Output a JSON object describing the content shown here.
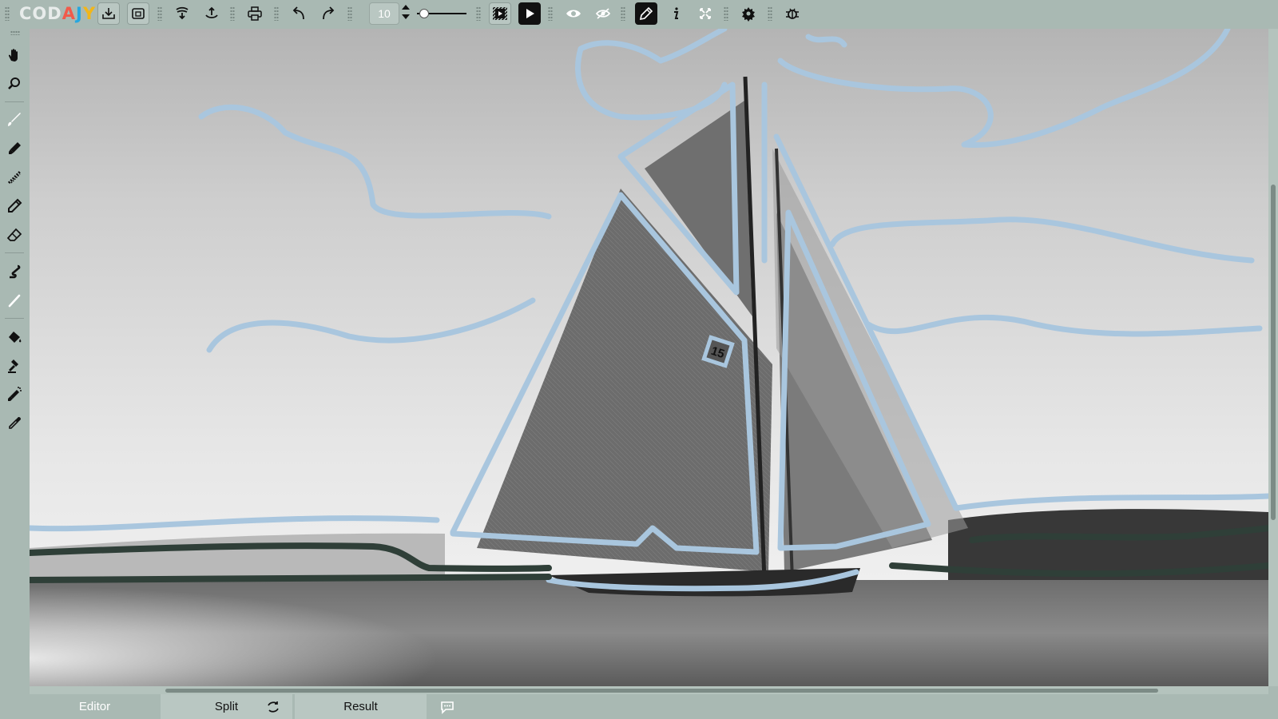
{
  "app": {
    "logo_letters": [
      {
        "char": "C",
        "color": "#e8eceb"
      },
      {
        "char": "O",
        "color": "#e8eceb"
      },
      {
        "char": "D",
        "color": "#e8eceb"
      },
      {
        "char": "A",
        "color": "#f15a4a"
      },
      {
        "char": "J",
        "color": "#26a7e0"
      },
      {
        "char": "Y",
        "color": "#f2b619"
      }
    ]
  },
  "toolbar": {
    "brush_size": "10",
    "slider_level": 0.05,
    "buttons": [
      {
        "name": "import-button",
        "icon": "download-tray-icon"
      },
      {
        "name": "gallery-button",
        "icon": "image-frame-icon"
      },
      {
        "name": "save-button",
        "icon": "save-icon"
      },
      {
        "name": "share-button",
        "icon": "share-icon"
      },
      {
        "name": "print-button",
        "icon": "printer-icon"
      },
      {
        "name": "undo-button",
        "icon": "undo-icon"
      },
      {
        "name": "redo-button",
        "icon": "redo-icon"
      },
      {
        "name": "playback-button",
        "icon": "playback-icon"
      },
      {
        "name": "play-button",
        "icon": "play-icon"
      },
      {
        "name": "preview-button",
        "icon": "eye-icon"
      },
      {
        "name": "hide-button",
        "icon": "eye-slash-icon"
      },
      {
        "name": "stylus-button",
        "icon": "stylus-icon"
      },
      {
        "name": "info-button",
        "icon": "info-icon"
      },
      {
        "name": "fullscreen-button",
        "icon": "expand-icon"
      },
      {
        "name": "settings-button",
        "icon": "gear-icon"
      },
      {
        "name": "debug-button",
        "icon": "bug-icon"
      }
    ]
  },
  "tools": [
    {
      "name": "hand-tool",
      "icon": "hand-icon"
    },
    {
      "name": "zoom-tool",
      "icon": "magnifier-icon"
    },
    {
      "name": "brush-tool",
      "icon": "brush-icon"
    },
    {
      "name": "marker-tool",
      "icon": "marker-icon"
    },
    {
      "name": "dotted-tool",
      "icon": "dotted-pen-icon"
    },
    {
      "name": "pencil-tool",
      "icon": "pencil-icon"
    },
    {
      "name": "eraser-tool",
      "icon": "eraser-icon"
    },
    {
      "name": "smudge-tool",
      "icon": "smudge-icon"
    },
    {
      "name": "line-tool",
      "icon": "line-icon"
    },
    {
      "name": "fill-tool",
      "icon": "paint-bucket-icon"
    },
    {
      "name": "stamp-tool",
      "icon": "stamp-icon"
    },
    {
      "name": "spray-tool",
      "icon": "spray-icon"
    },
    {
      "name": "eyedropper-tool",
      "icon": "eyedropper-icon"
    }
  ],
  "canvas": {
    "subject": "sailboat",
    "sail_number": "15",
    "stroke_colors": {
      "light": "#a9c6de",
      "dark": "#2f3f38"
    }
  },
  "tabs": {
    "editor": "Editor",
    "split": "Split",
    "result": "Result"
  }
}
